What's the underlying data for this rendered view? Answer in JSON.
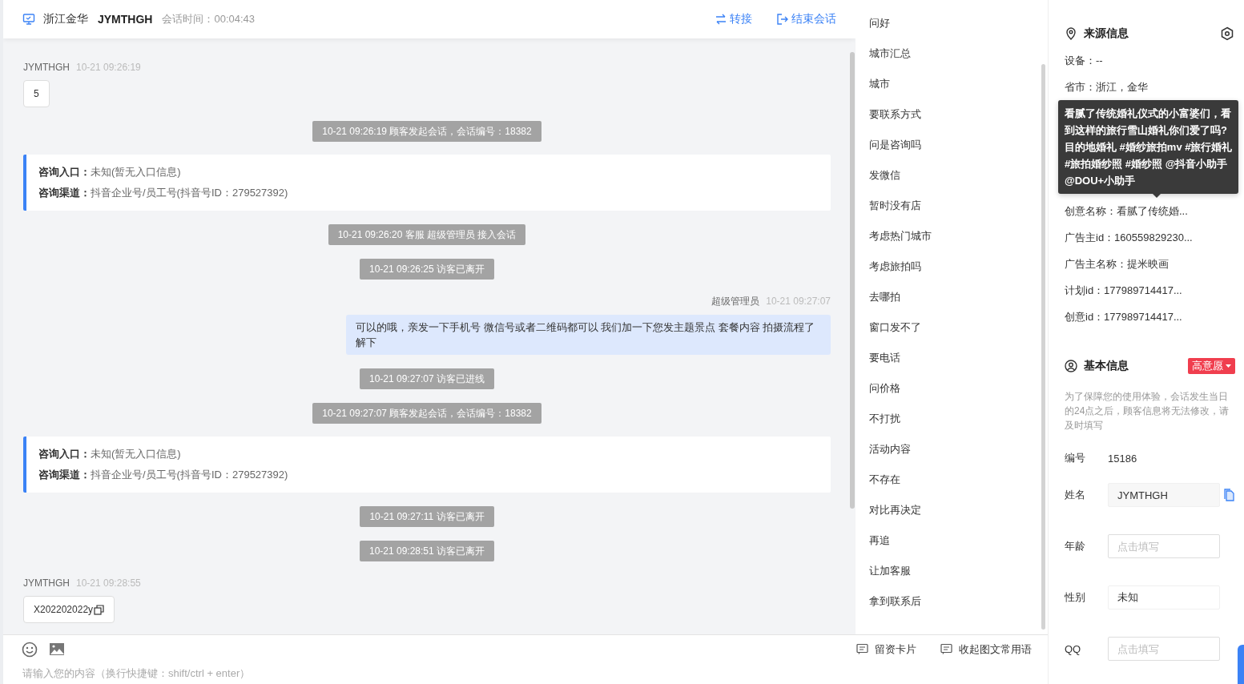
{
  "header": {
    "location": "浙江金华",
    "visitor": "JYMTHGH",
    "duration": "会话时间：00:04:43",
    "actions": [
      {
        "kind": "transfer",
        "label": "转接"
      },
      {
        "kind": "end",
        "label": "结束会话"
      }
    ]
  },
  "messages": [
    {
      "kind": "visitor",
      "name": "JYMTHGH",
      "time": "10-21 09:26:19",
      "text": "5",
      "copyable": false
    },
    {
      "kind": "system",
      "text": "10-21 09:26:19 顾客发起会话，会话编号：18382"
    },
    {
      "kind": "card",
      "rows": [
        {
          "label": "咨询入口：",
          "value": "未知(暂无入口信息)"
        },
        {
          "label": "咨询渠道：",
          "value": "抖音企业号/员工号(抖音号ID：279527392)"
        }
      ]
    },
    {
      "kind": "system",
      "text": "10-21 09:26:20 客服 超级管理员 接入会话"
    },
    {
      "kind": "system",
      "text": "10-21 09:26:25 访客已离开"
    },
    {
      "kind": "agent",
      "name": "超级管理员",
      "time": "10-21 09:27:07",
      "text": "可以的哦，亲发一下手机号 微信号或者二维码都可以 我们加一下您发主题景点 套餐内容 拍摄流程了解下"
    },
    {
      "kind": "system",
      "text": "10-21 09:27:07 访客已进线"
    },
    {
      "kind": "system",
      "text": "10-21 09:27:07 顾客发起会话，会话编号：18382"
    },
    {
      "kind": "card",
      "rows": [
        {
          "label": "咨询入口：",
          "value": "未知(暂无入口信息)"
        },
        {
          "label": "咨询渠道：",
          "value": "抖音企业号/员工号(抖音号ID：279527392)"
        }
      ]
    },
    {
      "kind": "system",
      "text": "10-21 09:27:11 访客已离开"
    },
    {
      "kind": "system",
      "text": "10-21 09:28:51 访客已离开"
    },
    {
      "kind": "visitor",
      "name": "JYMTHGH",
      "time": "10-21 09:28:55",
      "text": "X202202022y",
      "copyable": true
    }
  ],
  "quick_replies": [
    "问好",
    "城市汇总",
    "城市",
    "要联系方式",
    "问是咨询吗",
    "发微信",
    "暂时没有店",
    "考虑热门城市",
    "考虑旅拍吗",
    "去哪拍",
    "窗口发不了",
    "要电话",
    "问价格",
    "不打扰",
    "活动内容",
    "不存在",
    "对比再决定",
    "再追",
    "让加客服",
    "拿到联系后"
  ],
  "composer": {
    "placeholder": "请输入您的内容（换行快捷键：shift/ctrl + enter）",
    "actions": [
      {
        "label": "留资卡片"
      },
      {
        "label": "收起图文常用语"
      }
    ]
  },
  "source_info": {
    "title": "来源信息",
    "rows_before": [
      "设备：--",
      "省市：浙江，金华"
    ],
    "tooltip": [
      "看腻了传统婚礼仪式的小富婆们，看",
      "到这样的旅行雪山婚礼你们爱了吗?",
      "目的地婚礼 #婚纱旅拍mv #旅行婚礼",
      "#旅拍婚纱照 #婚纱照 @抖音小助手",
      "@DOU+小助手"
    ],
    "rows_after": [
      "创意名称：看腻了传统婚...",
      "广告主id：160559829230...",
      "广告主名称：提米映画",
      "计划id：177989714417...",
      "创意id：177989714417..."
    ]
  },
  "basic_info": {
    "title": "基本信息",
    "intent_tag": "高意愿",
    "notice": "为了保障您的使用体验，会话发生当日的24点之后，顾客信息将无法修改，请及时填写",
    "fields": [
      {
        "kind": "static",
        "label": "编号",
        "value": "15186"
      },
      {
        "kind": "locked",
        "label": "姓名",
        "value": "JYMTHGH"
      },
      {
        "kind": "input",
        "label": "年龄",
        "placeholder": "点击填写"
      },
      {
        "kind": "input",
        "label": "性别",
        "value": "未知"
      },
      {
        "kind": "input",
        "label": "QQ",
        "placeholder": "点击填写"
      }
    ]
  }
}
